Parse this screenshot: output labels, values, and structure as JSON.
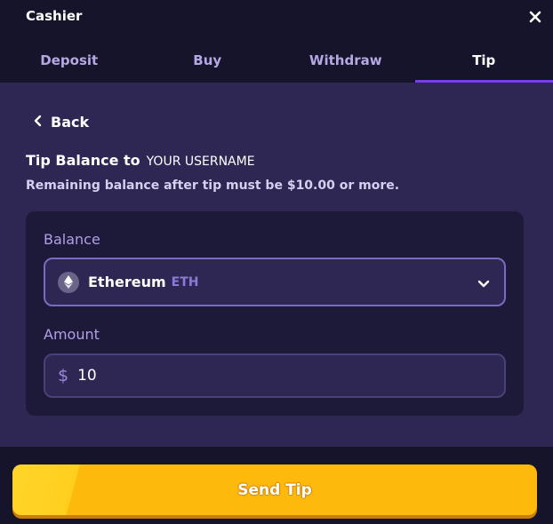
{
  "header": {
    "title": "Cashier",
    "close_icon": "close-icon",
    "tabs": [
      {
        "label": "Deposit",
        "active": false
      },
      {
        "label": "Buy",
        "active": false
      },
      {
        "label": "Withdraw",
        "active": false
      },
      {
        "label": "Tip",
        "active": true
      }
    ]
  },
  "main": {
    "back_label": "Back",
    "back_icon": "chevron-left-icon",
    "tip_title": "Tip Balance to",
    "recipient": "YOUR USERNAME",
    "note": "Remaining balance after tip must be $10.00 or more.",
    "balance": {
      "label": "Balance",
      "coin_name": "Ethereum",
      "coin_code": "ETH",
      "coin_icon": "ethereum-icon",
      "dropdown_icon": "chevron-down-icon"
    },
    "amount": {
      "label": "Amount",
      "currency_symbol": "$",
      "value": "10"
    }
  },
  "footer": {
    "send_label": "Send Tip"
  },
  "colors": {
    "background_dark": "#15142b",
    "panel": "#2e2753",
    "card": "#1c1a38",
    "accent_tab": "#7b3cf0",
    "label_purple": "#b39ee8",
    "button_yellow": "#fdb90c"
  }
}
